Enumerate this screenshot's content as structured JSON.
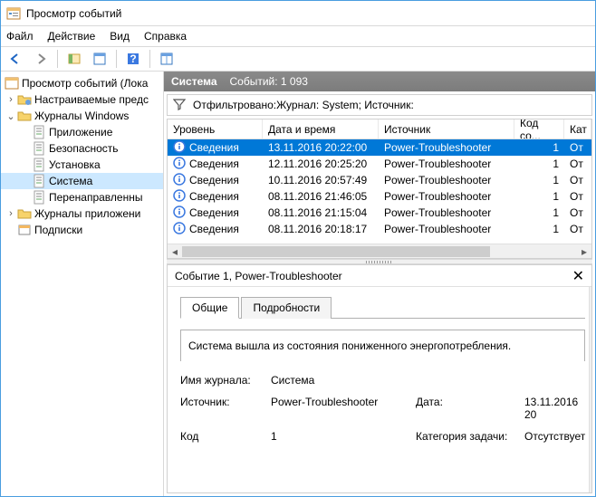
{
  "window": {
    "title": "Просмотр событий"
  },
  "menu": {
    "file": "Файл",
    "action": "Действие",
    "view": "Вид",
    "help": "Справка"
  },
  "tree": {
    "root": "Просмотр событий (Лока",
    "custom": "Настраиваемые предс",
    "winlogs": "Журналы Windows",
    "app": "Приложение",
    "security": "Безопасность",
    "setup": "Установка",
    "system": "Система",
    "forwarded": "Перенаправленны",
    "applogs": "Журналы приложени",
    "subs": "Подписки"
  },
  "header": {
    "title": "Система",
    "count_label": "Событий: 1 093"
  },
  "filter": {
    "text": "Отфильтровано:Журнал: System; Источник:"
  },
  "columns": {
    "level": "Уровень",
    "datetime": "Дата и время",
    "source": "Источник",
    "eventid": "Код со...",
    "cat": "Кат"
  },
  "rows": [
    {
      "level": "Сведения",
      "dt": "13.11.2016 20:22:00",
      "src": "Power-Troubleshooter",
      "id": "1",
      "cat": "От"
    },
    {
      "level": "Сведения",
      "dt": "12.11.2016 20:25:20",
      "src": "Power-Troubleshooter",
      "id": "1",
      "cat": "От"
    },
    {
      "level": "Сведения",
      "dt": "10.11.2016 20:57:49",
      "src": "Power-Troubleshooter",
      "id": "1",
      "cat": "От"
    },
    {
      "level": "Сведения",
      "dt": "08.11.2016 21:46:05",
      "src": "Power-Troubleshooter",
      "id": "1",
      "cat": "От"
    },
    {
      "level": "Сведения",
      "dt": "08.11.2016 21:15:04",
      "src": "Power-Troubleshooter",
      "id": "1",
      "cat": "От"
    },
    {
      "level": "Сведения",
      "dt": "08.11.2016 20:18:17",
      "src": "Power-Troubleshooter",
      "id": "1",
      "cat": "От"
    }
  ],
  "detail": {
    "title": "Событие 1, Power-Troubleshooter",
    "tab_general": "Общие",
    "tab_details": "Подробности",
    "message": "Система вышла из состояния пониженного энергопотребления.",
    "labels": {
      "logname": "Имя журнала:",
      "source": "Источник:",
      "eventid": "Код",
      "date": "Дата:",
      "category": "Категория задачи:"
    },
    "values": {
      "logname": "Система",
      "source": "Power-Troubleshooter",
      "eventid": "1",
      "date": "13.11.2016 20",
      "category": "Отсутствует"
    }
  }
}
